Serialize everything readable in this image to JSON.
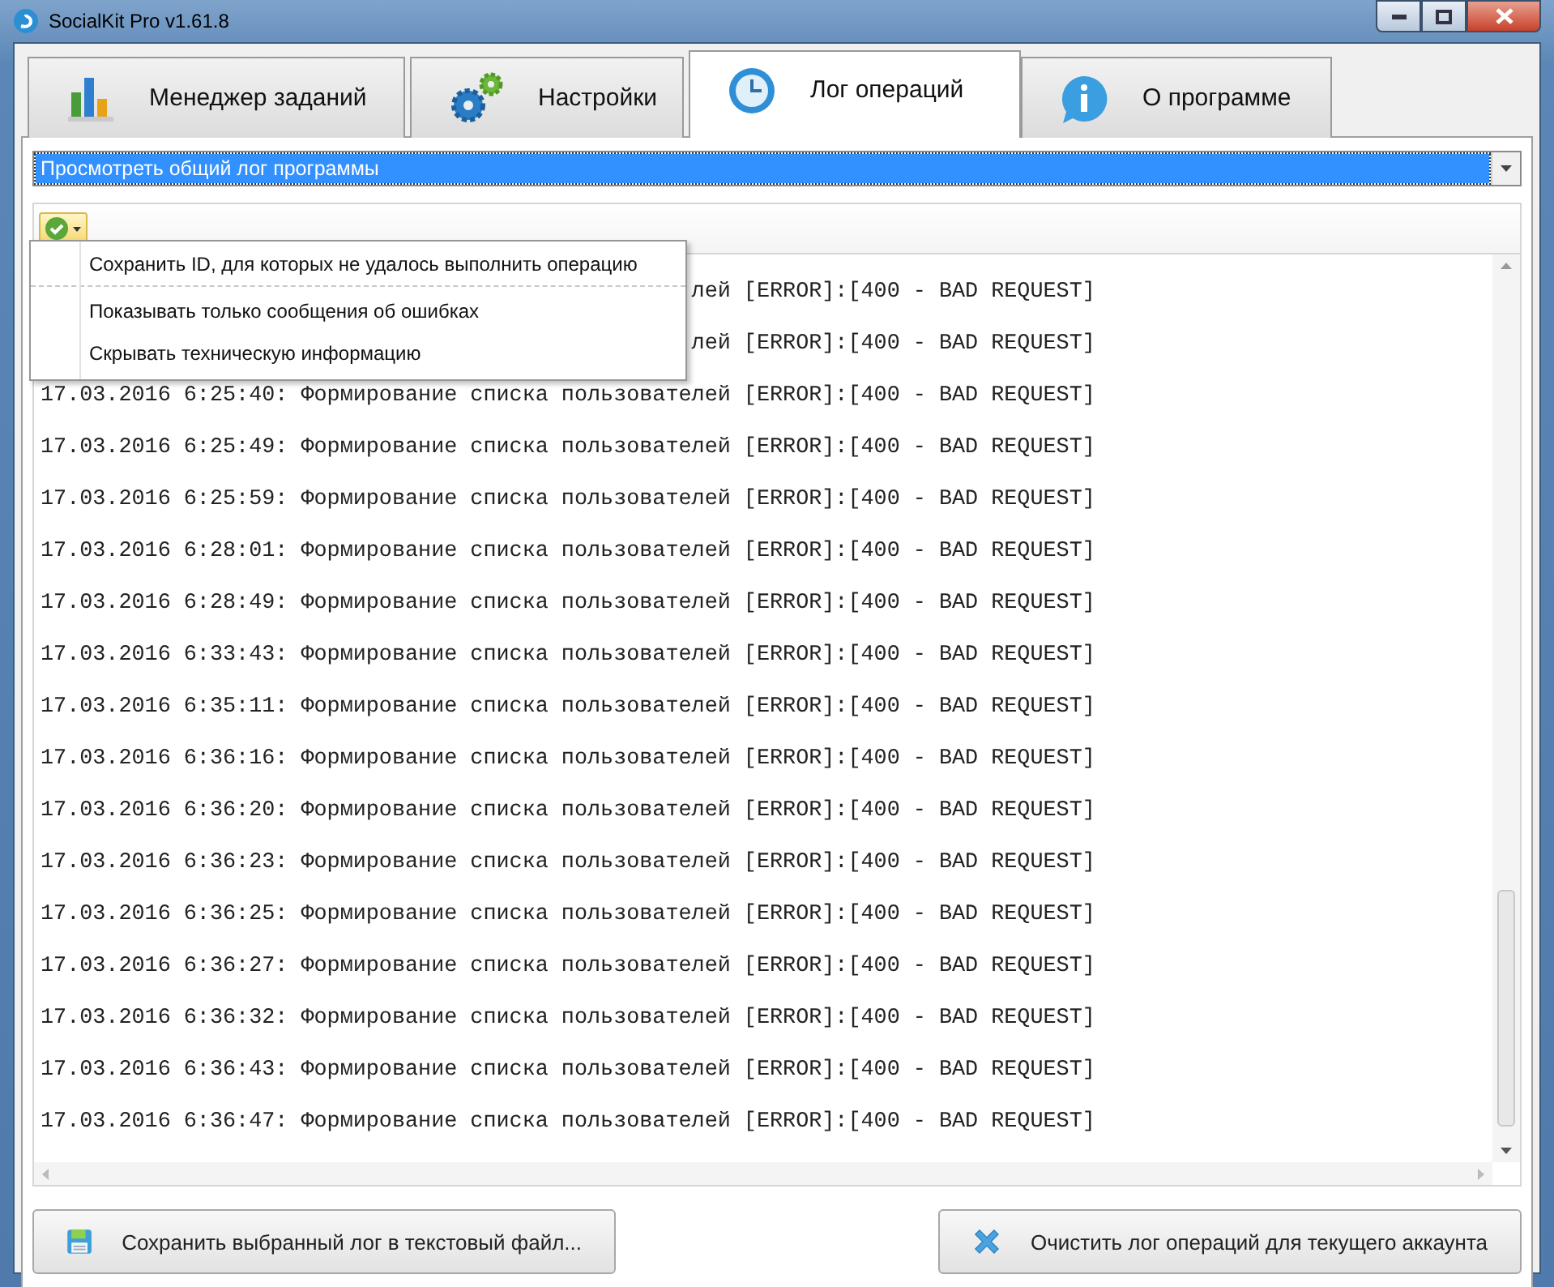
{
  "window": {
    "title": "SocialKit Pro v1.61.8"
  },
  "tabs": [
    {
      "label": "Менеджер заданий",
      "selected": false
    },
    {
      "label": "Настройки",
      "selected": false
    },
    {
      "label": "Лог операций",
      "selected": true
    },
    {
      "label": "О программе",
      "selected": false
    }
  ],
  "log_selector": {
    "value": "Просмотреть общий лог программы"
  },
  "options_menu": {
    "expanded": true,
    "items": [
      {
        "label": "Сохранить ID, для которых не удалось выполнить операцию",
        "separator_after": true
      },
      {
        "label": "Показывать только сообщения об ошибках",
        "separator_after": false
      },
      {
        "label": "Скрывать техническую информацию",
        "separator_after": false
      }
    ]
  },
  "log_lines": [
    "лей [ERROR]:[400 - BAD REQUEST]",
    "лей [ERROR]:[400 - BAD REQUEST]",
    "17.03.2016 6:25:40: Формирование списка пользователей [ERROR]:[400 - BAD REQUEST]",
    "17.03.2016 6:25:49: Формирование списка пользователей [ERROR]:[400 - BAD REQUEST]",
    "17.03.2016 6:25:59: Формирование списка пользователей [ERROR]:[400 - BAD REQUEST]",
    "17.03.2016 6:28:01: Формирование списка пользователей [ERROR]:[400 - BAD REQUEST]",
    "17.03.2016 6:28:49: Формирование списка пользователей [ERROR]:[400 - BAD REQUEST]",
    "17.03.2016 6:33:43: Формирование списка пользователей [ERROR]:[400 - BAD REQUEST]",
    "17.03.2016 6:35:11: Формирование списка пользователей [ERROR]:[400 - BAD REQUEST]",
    "17.03.2016 6:36:16: Формирование списка пользователей [ERROR]:[400 - BAD REQUEST]",
    "17.03.2016 6:36:20: Формирование списка пользователей [ERROR]:[400 - BAD REQUEST]",
    "17.03.2016 6:36:23: Формирование списка пользователей [ERROR]:[400 - BAD REQUEST]",
    "17.03.2016 6:36:25: Формирование списка пользователей [ERROR]:[400 - BAD REQUEST]",
    "17.03.2016 6:36:27: Формирование списка пользователей [ERROR]:[400 - BAD REQUEST]",
    "17.03.2016 6:36:32: Формирование списка пользователей [ERROR]:[400 - BAD REQUEST]",
    "17.03.2016 6:36:43: Формирование списка пользователей [ERROR]:[400 - BAD REQUEST]",
    "17.03.2016 6:36:47: Формирование списка пользователей [ERROR]:[400 - BAD REQUEST]"
  ],
  "buttons": [
    {
      "label": "Сохранить выбранный лог в текстовый файл..."
    },
    {
      "label": "Очистить лог операций для текущего аккаунта"
    }
  ]
}
